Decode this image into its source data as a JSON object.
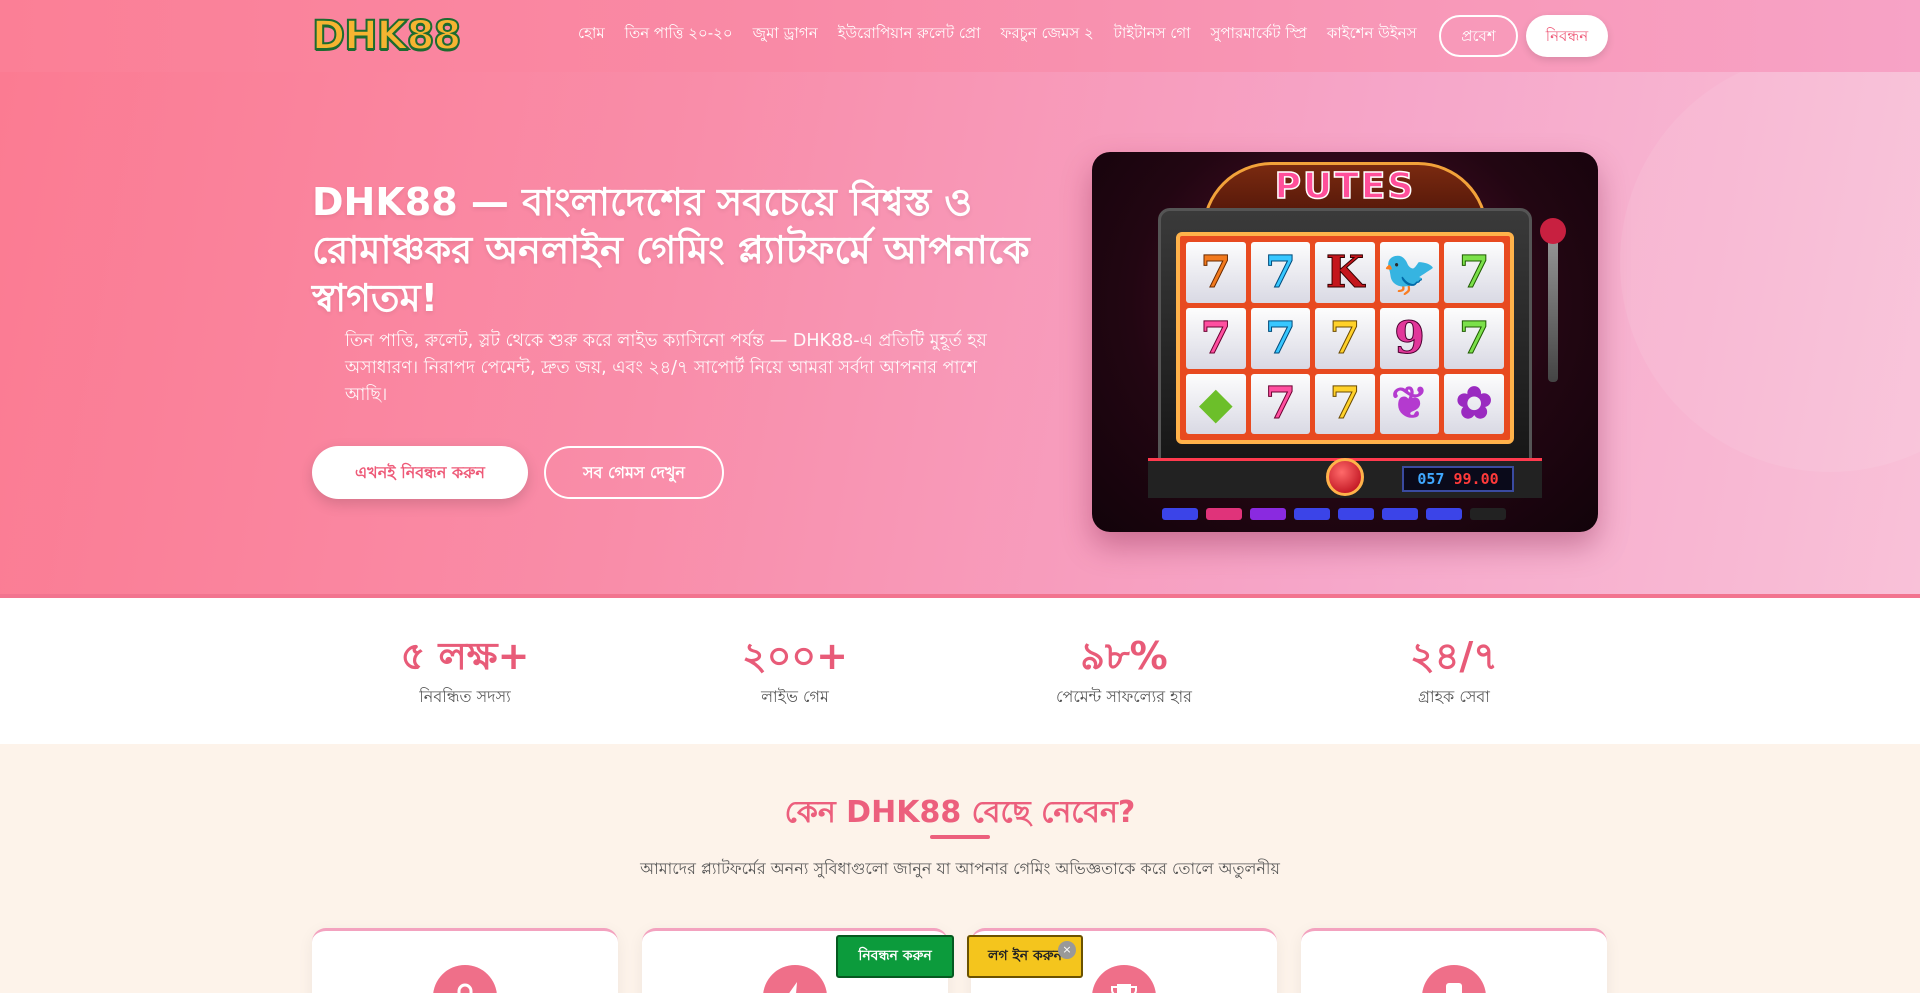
{
  "header": {
    "logo": "DHK88",
    "nav": [
      "হোম",
      "তিন পাত্তি ২০-২০",
      "জুমা ড্রাগন",
      "ইউরোপিয়ান রুলেট প্রো",
      "ফরচুন জেমস ২",
      "টাইটানস গো",
      "সুপারমার্কেট স্প্রি",
      "কাইশেন উইনস"
    ],
    "login": "প্রবেশ",
    "register": "নিবন্ধন"
  },
  "hero": {
    "title": "DHK88 — বাংলাদেশের সবচেয়ে বিশ্বস্ত ও রোমাঞ্চকর অনলাইন গেমিং প্ল্যাটফর্মে আপনাকে স্বাগতম!",
    "description": "তিন পাত্তি, রুলেট, স্লট থেকে শুরু করে লাইভ ক্যাসিনো পর্যন্ত — DHK88-এ প্রতিটি মুহূর্ত হয় অসাধারণ। নিরাপদ পেমেন্ট, দ্রুত জয়, এবং ২৪/৭ সাপোর্ট নিয়ে আমরা সর্বদা আপনার পাশে আছি।",
    "cta_primary": "এখনই নিবন্ধন করুন",
    "cta_secondary": "সব গেমস দেখুন",
    "image": {
      "sign": "PUTES",
      "display_blue": "057",
      "display_red": "99.00",
      "reels": [
        "7",
        "7",
        "K",
        "🐦",
        "7",
        "7",
        "7",
        "7",
        "9",
        "7",
        "◆",
        "7",
        "7",
        "❦",
        "✿"
      ]
    }
  },
  "stats": [
    {
      "value": "৫ লক্ষ+",
      "label": "নিবন্ধিত সদস্য"
    },
    {
      "value": "২০০+",
      "label": "লাইভ গেম"
    },
    {
      "value": "৯৮%",
      "label": "পেমেন্ট সাফল্যের হার"
    },
    {
      "value": "২৪/৭",
      "label": "গ্রাহক সেবা"
    }
  ],
  "why": {
    "title": "কেন DHK88 বেছে নেবেন?",
    "subtitle": "আমাদের প্ল্যাটফর্মের অনন্য সুবিধাগুলো জানুন যা আপনার গেমিং অভিজ্ঞতাকে করে তোলে অতুলনীয়",
    "card_icons": [
      "lock-icon",
      "lightning-icon",
      "trophy-icon",
      "phone-icon"
    ]
  },
  "floating": {
    "register": "নিবন্ধন করুন",
    "login": "লগ ইন করুন",
    "close": "×"
  },
  "colors": {
    "accent": "#ec5f7d",
    "header_start": "#fb7f96",
    "register_green": "#0c9b3c",
    "login_yellow": "#f4c51d"
  }
}
